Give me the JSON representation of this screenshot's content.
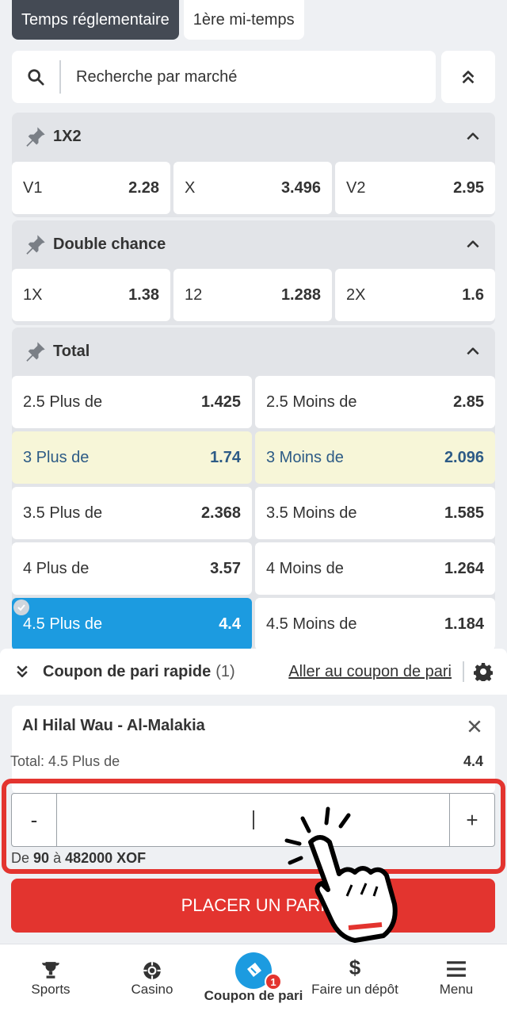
{
  "tabs": [
    {
      "label": "Temps réglementaire",
      "active": true
    },
    {
      "label": "1ère mi-temps",
      "active": false
    }
  ],
  "search": {
    "placeholder": "Recherche par marché"
  },
  "markets": {
    "m1x2": {
      "title": "1X2",
      "odds": [
        {
          "label": "V1",
          "value": "2.28"
        },
        {
          "label": "X",
          "value": "3.496"
        },
        {
          "label": "V2",
          "value": "2.95"
        }
      ]
    },
    "double_chance": {
      "title": "Double chance",
      "odds": [
        {
          "label": "1X",
          "value": "1.38"
        },
        {
          "label": "12",
          "value": "1.288"
        },
        {
          "label": "2X",
          "value": "1.6"
        }
      ]
    },
    "total": {
      "title": "Total",
      "rows": [
        [
          {
            "label": "2.5 Plus de",
            "value": "1.425"
          },
          {
            "label": "2.5 Moins de",
            "value": "2.85"
          }
        ],
        [
          {
            "label": "3 Plus de",
            "value": "1.74"
          },
          {
            "label": "3 Moins de",
            "value": "2.096"
          }
        ],
        [
          {
            "label": "3.5 Plus de",
            "value": "2.368"
          },
          {
            "label": "3.5 Moins de",
            "value": "1.585"
          }
        ],
        [
          {
            "label": "4 Plus de",
            "value": "3.57"
          },
          {
            "label": "4 Moins de",
            "value": "1.264"
          }
        ],
        [
          {
            "label": "4.5 Plus de",
            "value": "4.4"
          },
          {
            "label": "4.5 Moins de",
            "value": "1.184"
          }
        ]
      ]
    }
  },
  "coupon": {
    "title": "Coupon de pari rapide",
    "count": "(1)",
    "link": "Aller au coupon de pari",
    "match": "Al Hilal Wau - Al-Malakia",
    "bet_type": "Total: 4.5 Plus de",
    "bet_odd": "4.4",
    "minus": "-",
    "plus": "+",
    "range_prefix": "De",
    "range_min": "90",
    "range_mid": "à",
    "range_max": "482000 XOF",
    "place_label": "PLACER UN PARI"
  },
  "nav": {
    "sports": "Sports",
    "casino": "Casino",
    "coupon": "Coupon de pari",
    "coupon_badge": "1",
    "deposit": "Faire un dépôt",
    "menu": "Menu"
  },
  "colors": {
    "accent_blue": "#1c9be0",
    "danger_red": "#e3342f",
    "highlight_yellow": "#f7f6d8"
  }
}
